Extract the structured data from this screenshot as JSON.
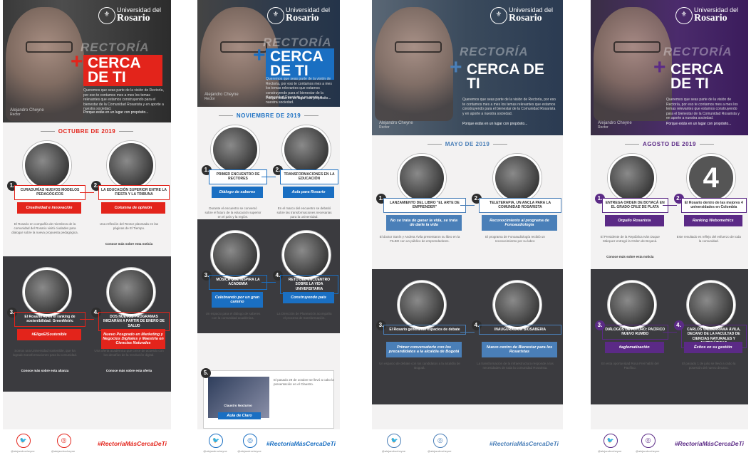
{
  "university": {
    "line1": "Universidad del",
    "line2": "Rosario"
  },
  "campaign": {
    "rectoria": "RECTORÍA",
    "plus": "+",
    "cerca": "CERCA DE TI",
    "blurb": "Queremos que seas parte de la visión de Rectoría, por eso te contamos mes a mes los temas relevantes que estamos construyendo para el bienestar de la Comunidad Rosarista y en aporte a nuestra sociedad.",
    "tagline": "Porque estás en un lugar con propósito...",
    "name": "Alejandro Cheyne",
    "role": "Rector"
  },
  "social": {
    "twitter_icon": "twitter-icon",
    "instagram_icon": "instagram-icon",
    "twitter": "@alejandrocheyne",
    "instagram": "@alejandrocheyne"
  },
  "panels": [
    {
      "accent": "#e3241b",
      "month": "OCTUBRE DE 2019",
      "hashtag": "#RectoríaMásCercaDeTi",
      "items": [
        {
          "n": "1.",
          "title": "CURADURÍAS NUEVOS MODELOS PEDAGÓGICOS",
          "tag": "Creatividad e innovación",
          "text": "El Rosario en compañía de miembros de la comunidad del Rosario visitó ciudades para dialogar sobre la nueva propuesta pedagógica."
        },
        {
          "n": "2.",
          "title": "LA EDUCACIÓN SUPERIOR ENTRE LA FIESTA Y LA TRIBUNA",
          "tag": "Columna de opinión",
          "text": "Una reflexión del Rector plasmada en las páginas de El Tiempo.",
          "more": "Conoce más sobre esta noticia"
        },
        {
          "n": "3.",
          "title": "El Rosario #1 en el ranking de sostenibilidad: GreenMetric",
          "tag": "#EligeElSostenible",
          "text": "Somos una Universidad sostenible, que ha logrado transformaciones para la comunidad.",
          "more": "Conoce más sobre esta alianza"
        },
        {
          "n": "4.",
          "title": "DOS NUEVOS PROGRAMAS INICIARÁN A PARTIR DE ENERO DE SALUD",
          "tag": "Nuevo Posgrado en Marketing y Negocios Digitales y Maestría en Ciencias Naturales",
          "text": "Una oferta académica que crece de acuerdo con los desafíos de la revolución digital.",
          "more": "Conoce más sobre esta oferta"
        }
      ]
    },
    {
      "accent": "#1a6fc2",
      "month": "NOVIEMBRE DE 2019",
      "hashtag": "#RectoríaMásCercaDeTi",
      "items": [
        {
          "n": "1.",
          "title": "PRIMER ENCUENTRO DE RECTORES",
          "tag": "Diálogo de saberes",
          "text": "Durante el encuentro se conversó sobre el futuro de la educación superior en el país y la región."
        },
        {
          "n": "2.",
          "title": "TRANSFORMACIONES EN LA EDUCACIÓN",
          "tag": "Aula para Rosario",
          "text": "En el marco del encuentro se debatió sobre las transformaciones necesarias para la universidad."
        },
        {
          "n": "3.",
          "title": "MÚSICA QUE INSPIRA LA ACADEMIA",
          "tag": "Celebrando por un gran camino",
          "text": "Un espacio para el diálogo de saberes con la comunidad académica."
        },
        {
          "n": "4.",
          "title": "RETO DEL ENCUENTRO SOBRE LA VIDA UNIVERSITARIA",
          "tag": "Construyendo país",
          "text": "La Dirección de Planeación acompaña el proceso de transformación."
        },
        {
          "n": "5.",
          "title": "Claustro Nocturno",
          "tag": "Aula de Claro",
          "text": "El pasado 29 de octubre se llevó a cabo la presentación en el Claustro."
        }
      ]
    },
    {
      "accent": "#4a7fb8",
      "month": "MAYO DE 2019",
      "hashtag": "#RectoríaMásCercaDeTi",
      "items": [
        {
          "n": "1.",
          "title": "LANZAMIENTO DEL LIBRO \"EL ARTE DE EMPRENDER\"",
          "tag": "No se trata de ganar la vida, se trata de darle la vida",
          "text": "El doctor Sanín y Andrea Ávila presentaron su libro en la FILBO con un público de emprendedores."
        },
        {
          "n": "2.",
          "title": "TELETERAPIA, UN ANCLA PARA LA COMUNIDAD ROSARISTA",
          "tag": "Reconocimiento al programa de Fonoaudiología",
          "text": "El programa de Fonoaudiología recibió un reconocimiento por su labor."
        },
        {
          "n": "3.",
          "title": "El Rosario generando espacios de debate",
          "tag": "Primer conversatorio con los precandidatos a la alcaldía de Bogotá",
          "text": "Un espacio de debate con los candidatos a la alcaldía de Bogotá."
        },
        {
          "n": "4.",
          "title": "INAUGURACIÓN BIOSABERIA",
          "tag": "Nuevo centro de Bienestar para los Rosaristas",
          "text": "La transformación de la infraestructura responde a las necesidades de toda la comunidad Rosarista."
        }
      ]
    },
    {
      "accent": "#5b2a86",
      "month": "AGOSTO DE 2019",
      "hashtag": "#RectoríaMásCercaDeTi",
      "items": [
        {
          "n": "1.",
          "title": "ENTREGA ORDEN DE BOYACÁ EN EL GRADO CRUZ DE PLATA",
          "tag": "Orgullo Rosarista",
          "text": "El Presidente de la República Iván Duque Márquez entregó la Orden de Boyacá.",
          "more": "Conoce más sobre esta noticia"
        },
        {
          "n": "2.",
          "title": "El Rosario dentro de las mejores 4 universidades en Colombia",
          "tag": "Ranking Webometrics",
          "text": "Este resultado es reflejo del esfuerzo de toda la comunidad.",
          "badge": "4"
        },
        {
          "n": "3.",
          "title": "DIÁLOGOS DE FUTURO: PACÍFICO NUEVO RUMBO",
          "tag": "#aglomatización",
          "text": "En esta oportunidad Rosa Frei habló del Pacífico."
        },
        {
          "n": "4.",
          "title": "CARLOS VALDERRAMA ÁVILA, DECANO DE LA FACULTAD DE CIENCIAS NATURALES Y MATEMÁTICAS",
          "tag": "Éxitos en su gestión",
          "text": "El pasado 1 de julio se llevó a cabo la posesión del nuevo decano."
        }
      ]
    }
  ]
}
